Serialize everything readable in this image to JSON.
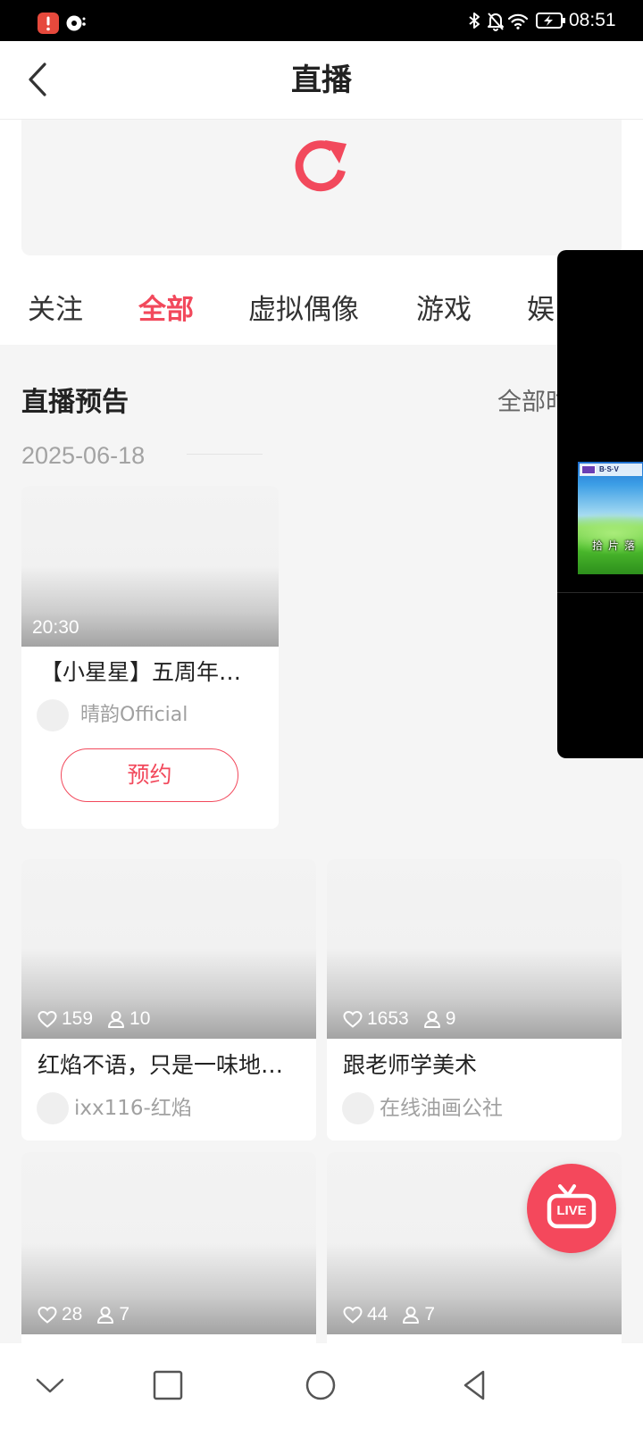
{
  "status_bar": {
    "time": "08:51",
    "icons": [
      "alert-notification-icon",
      "disc-app-icon",
      "bluetooth-icon",
      "bell-off-icon",
      "wifi-icon",
      "battery-charging-icon"
    ]
  },
  "header": {
    "title": "直播",
    "back_icon": "chevron-left-icon"
  },
  "banner": {
    "icon": "refresh-icon"
  },
  "tabs": [
    {
      "label": "关注",
      "selected": false
    },
    {
      "label": "全部",
      "selected": true
    },
    {
      "label": "虚拟偶像",
      "selected": false
    },
    {
      "label": "游戏",
      "selected": false
    },
    {
      "label": "娱",
      "selected": false
    }
  ],
  "preview": {
    "section_title": "直播预告",
    "more_label": "全部时",
    "date": "2025-06-18",
    "card": {
      "start_time": "20:30",
      "title": "【小星星】五周年…",
      "host": "晴韵Official",
      "button_label": "预约"
    }
  },
  "live_cards": [
    {
      "likes": "159",
      "viewers": "10",
      "title": "红焰不语，只是一味地…",
      "host": "ixx116-红焰"
    },
    {
      "likes": "1653",
      "viewers": "9",
      "title": "跟老师学美术",
      "host": "在线油画公社"
    },
    {
      "likes": "28",
      "viewers": "7"
    },
    {
      "likes": "44",
      "viewers": "7"
    }
  ],
  "floating_live_button": {
    "label": "LIVE",
    "icon": "tv-icon"
  },
  "mini_player": {
    "logo_text": "B·S·V",
    "subtitle": "拾片落"
  },
  "nav_bar": {
    "icons": [
      "chevron-down-icon",
      "square-recents-icon",
      "circle-home-icon",
      "triangle-back-icon"
    ]
  },
  "colors": {
    "accent": "#f2495c",
    "page_background": "#f5f5f5",
    "status_bar": "#000000"
  }
}
